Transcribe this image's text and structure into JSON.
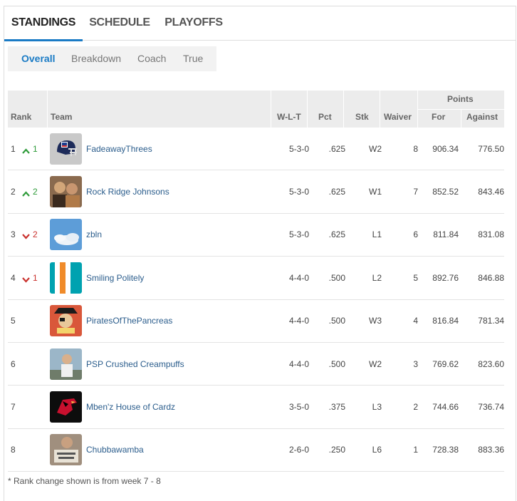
{
  "tabs": {
    "standings": "STANDINGS",
    "schedule": "SCHEDULE",
    "playoffs": "PLAYOFFS"
  },
  "subtabs": {
    "overall": "Overall",
    "breakdown": "Breakdown",
    "coach": "Coach",
    "true": "True"
  },
  "headers": {
    "rank": "Rank",
    "team": "Team",
    "wlt": "W-L-T",
    "pct": "Pct",
    "stk": "Stk",
    "waiver": "Waiver",
    "points": "Points",
    "for": "For",
    "against": "Against"
  },
  "accent_color": "#1a7bc5",
  "rows": [
    {
      "rank": "1",
      "change_dir": "up",
      "change": "1",
      "avatar": "nfl-helmet-icon",
      "team": "FadeawayThrees",
      "wlt": "5-3-0",
      "pct": ".625",
      "stk": "W2",
      "waiver": "8",
      "pf": "906.34",
      "pa": "776.50"
    },
    {
      "rank": "2",
      "change_dir": "up",
      "change": "2",
      "avatar": "photo-people",
      "team": "Rock Ridge Johnsons",
      "wlt": "5-3-0",
      "pct": ".625",
      "stk": "W1",
      "waiver": "7",
      "pf": "852.52",
      "pa": "843.46"
    },
    {
      "rank": "3",
      "change_dir": "down",
      "change": "2",
      "avatar": "photo-sky",
      "team": "zbln",
      "wlt": "5-3-0",
      "pct": ".625",
      "stk": "L1",
      "waiver": "6",
      "pf": "811.84",
      "pa": "831.08"
    },
    {
      "rank": "4",
      "change_dir": "down",
      "change": "1",
      "avatar": "dolphins-stripes",
      "team": "Smiling Politely",
      "wlt": "4-4-0",
      "pct": ".500",
      "stk": "L2",
      "waiver": "5",
      "pf": "892.76",
      "pa": "846.88"
    },
    {
      "rank": "5",
      "change_dir": "",
      "change": "",
      "avatar": "pirate-logo",
      "team": "PiratesOfThePancreas",
      "wlt": "4-4-0",
      "pct": ".500",
      "stk": "W3",
      "waiver": "4",
      "pf": "816.84",
      "pa": "781.34"
    },
    {
      "rank": "6",
      "change_dir": "",
      "change": "",
      "avatar": "photo-person",
      "team": "PSP Crushed Creampuffs",
      "wlt": "4-4-0",
      "pct": ".500",
      "stk": "W2",
      "waiver": "3",
      "pf": "769.62",
      "pa": "823.60"
    },
    {
      "rank": "7",
      "change_dir": "",
      "change": "",
      "avatar": "cardinals-logo",
      "team": "Mben'z House of Cardz",
      "wlt": "3-5-0",
      "pct": ".375",
      "stk": "L3",
      "waiver": "2",
      "pf": "744.66",
      "pa": "736.74"
    },
    {
      "rank": "8",
      "change_dir": "",
      "change": "",
      "avatar": "photo-man-sign",
      "team": "Chubbawamba",
      "wlt": "2-6-0",
      "pct": ".250",
      "stk": "L6",
      "waiver": "1",
      "pf": "728.38",
      "pa": "883.36"
    }
  ],
  "footnote": "* Rank change shown is from week 7 - 8"
}
